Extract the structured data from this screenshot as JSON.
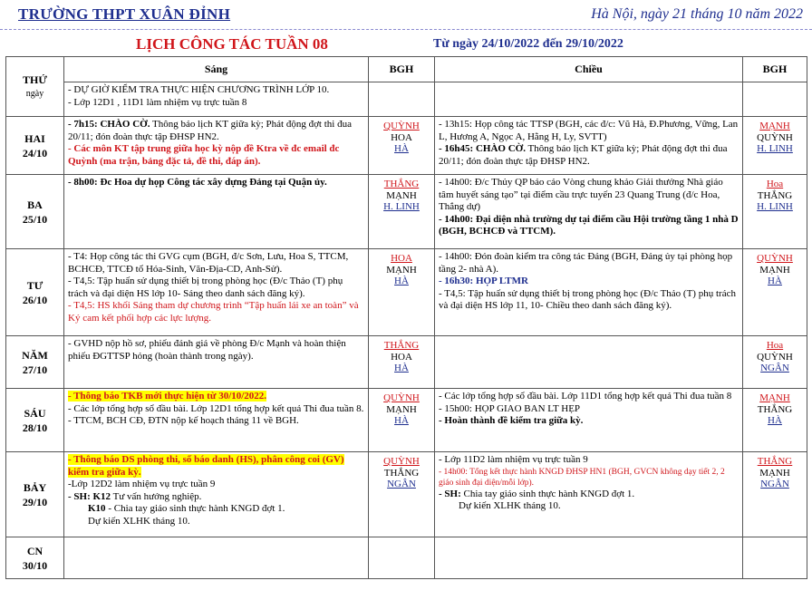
{
  "header": {
    "school": "TRƯỜNG THPT XUÂN ĐỈNH",
    "date": "Hà Nội, ngày 21 tháng 10 năm 2022",
    "title": "LỊCH CÔNG TÁC TUẦN 08",
    "range": "Từ ngày 24/10/2022 đến 29/10/2022"
  },
  "columns": {
    "day": "THỨ",
    "day_sub": "ngày",
    "morning": "Sáng",
    "bgh": "BGH",
    "afternoon": "Chiều"
  },
  "days": [
    {
      "name": "",
      "date": "",
      "morning": [
        "- DỰ GIỜ KIỂM TRA THỰC HIỆN CHƯƠNG TRÌNH LỚP 10.",
        "- Lớp 12D1 , 11D1 làm nhiệm vụ trực tuần 8"
      ],
      "afternoon": []
    },
    {
      "name": "HAI",
      "date": "24/10",
      "morning_1": "- 7h15: CHÀO CỜ.",
      "morning_1b": " Thông báo lịch KT giữa kỳ; Phát động đợt thi đua 20/11; đón đoàn thực tập ĐHSP HN2.",
      "morning_2": "- Các môn KT tập trung giữa học kỳ nộp đề Ktra về đc email đc Quỳnh (ma trận, bảng đặc tả, đề thi, đáp án).",
      "bgh_am": [
        "QUỲNH",
        "HOA",
        "HÀ"
      ],
      "afternoon_1": "- 13h15: Họp công tác TTSP (BGH, các đ/c: Vũ Hà, Đ.Phương, Vững, Lan L, Hương A, Ngọc A, Hằng H, Ly, SVTT)",
      "afternoon_2": "- 16h45: CHÀO CỜ.",
      "afternoon_2b": " Thông báo lịch KT giữa kỳ; Phát động đợt thi đua 20/11; đón đoàn thực tập ĐHSP HN2.",
      "bgh_pm": [
        "MẠNH",
        "QUỲNH",
        "H. LINH"
      ]
    },
    {
      "name": "BA",
      "date": "25/10",
      "morning_1": "- 8h00: Đc Hoa dự họp Công tác xây dựng Đảng tại Quận ủy.",
      "bgh_am": [
        "THẮNG",
        "MẠNH",
        "H. LINH"
      ],
      "afternoon_1": "- 14h00: Đ/c Thủy QP báo cáo Vòng chung khảo Giải thưởng Nhà giáo tâm huyết sáng tạo” tại điểm cầu trực tuyến 23 Quang Trung (đ/c Hoa, Thắng dự)",
      "afternoon_2": "- 14h00: Đại diện nhà trường dự tại điểm cầu Hội trường tầng 1 nhà D (BGH, BCHCĐ và TTCM).",
      "bgh_pm": [
        "Hoa",
        "THẮNG",
        "H. LINH"
      ]
    },
    {
      "name": "TƯ",
      "date": "26/10",
      "morning_1": "- T4: Họp công tác thi GVG cụm (BGH, đ/c Sơn, Lưu, Hoa S, TTCM, BCHCĐ, TTCĐ tổ Hóa-Sinh, Văn-Địa-CD, Anh-Sử).",
      "morning_2": "- T4,5: Tập huấn sử dụng thiết bị trong phòng học (Đ/c Thảo (T) phụ trách và đại diện HS lớp 10- Sáng theo danh sách đăng ký).",
      "morning_3": "- T4,5: HS khối Sáng tham dự chương trình “Tập huấn lái xe an toàn” và Ký cam kết phối hợp các lực lượng.",
      "bgh_am": [
        "HOA",
        "MẠNH",
        "HÀ"
      ],
      "afternoon_1": "- 14h00: Đón đoàn kiểm tra công tác Đảng (BGH, Đảng ủy tại phòng họp tầng 2- nhà A).",
      "afternoon_2": "- 16h30: HỌP LTMR",
      "afternoon_3": "- T4,5: Tập huấn sử dụng thiết bị trong phòng học (Đ/c Thảo (T) phụ trách và đại diện HS lớp 11, 10- Chiều theo danh sách đăng ký).",
      "bgh_pm": [
        "QUỲNH",
        "MẠNH",
        "HÀ"
      ]
    },
    {
      "name": "NĂM",
      "date": "27/10",
      "morning_1": "- GVHD nộp hồ sơ, phiếu đánh giá về phòng Đ/c Mạnh và hoàn thiện phiếu ĐGTTSP hỏng (hoàn thành trong ngày).",
      "bgh_am": [
        "THẮNG",
        "HOA",
        "HÀ"
      ],
      "bgh_pm": [
        "Hoa",
        "QUỲNH",
        "NGÂN"
      ]
    },
    {
      "name": "SÁU",
      "date": "28/10",
      "morning_1": "- Thông báo TKB mới thực hiện từ 30/10/2022.",
      "morning_2": "- Các lớp tổng hợp sổ đầu bài. Lớp 12D1 tổng hợp kết quả Thi đua tuần 8.",
      "morning_3": "- TTCM, BCH CĐ, ĐTN nộp kế hoạch tháng 11 về BGH.",
      "bgh_am": [
        "QUỲNH",
        "MẠNH",
        "HÀ"
      ],
      "afternoon_1": "- Các lớp tổng hợp sổ đầu bài. Lớp 11D1 tổng hợp kết quả Thi đua tuần 8",
      "afternoon_2": "- 15h00: HỌP GIAO BAN LT HẸP",
      "afternoon_3": "- Hoàn thành đề kiểm tra giữa kỳ.",
      "bgh_pm": [
        "MẠNH",
        "THẮNG",
        "HÀ"
      ]
    },
    {
      "name": "BẢY",
      "date": "29/10",
      "morning_1": "- Thông báo DS phòng thi, số báo danh (HS), phân công coi (GV) kiểm tra giữa kỳ.",
      "morning_2": "-Lớp 12D2 làm nhiệm vụ trực tuần 9",
      "morning_3a": "- SH:",
      "morning_3b": " K12",
      "morning_3c": " Tư vấn hướng nghiệp.",
      "morning_4a": "K10",
      "morning_4b": " - Chia tay giáo sinh thực hành KNGD đợt 1.",
      "morning_5": "Dự kiến XLHK tháng 10.",
      "bgh_am": [
        "QUỲNH",
        "THẮNG",
        "NGÂN"
      ],
      "afternoon_1": "- Lớp 11D2 làm nhiệm vụ trực tuần 9",
      "afternoon_2": "- 14h00: Tổng kết thực hành KNGD ĐHSP HN1 (BGH, GVCN không dạy tiết 2, 2 giáo sinh đại diện/mỗi lớp).",
      "afternoon_3a": "- SH:",
      "afternoon_3b": " Chia tay giáo sinh thực hành KNGD đợt 1.",
      "afternoon_4": "Dự kiến XLHK tháng 10.",
      "bgh_pm": [
        "THẮNG",
        "MẠNH",
        "NGÂN"
      ]
    },
    {
      "name": "CN",
      "date": "30/10"
    }
  ]
}
